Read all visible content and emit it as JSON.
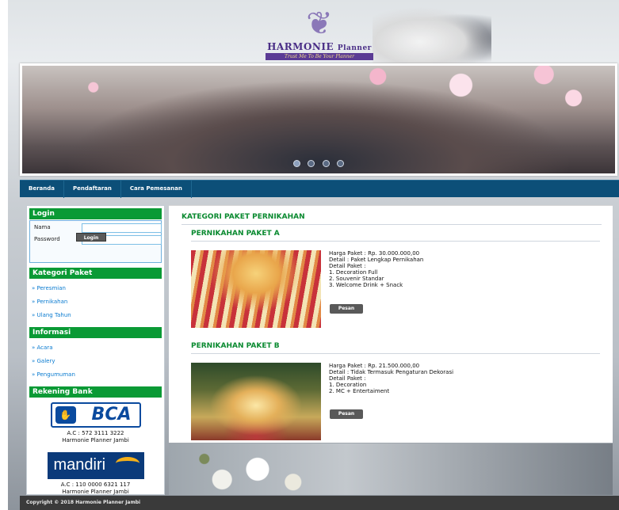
{
  "logo": {
    "title": "HARMONIE",
    "title_small": "Planner",
    "tagline": "Trust Me To Be Your Planner"
  },
  "nav": {
    "items": [
      "Beranda",
      "Pendaftaran",
      "Cara Pemesanan"
    ]
  },
  "sidebar": {
    "login": {
      "heading": "Login",
      "nama_label": "Nama",
      "password_label": "Password",
      "button": "Login"
    },
    "kategori": {
      "heading": "Kategori Paket",
      "items": [
        "» Peresmian",
        "» Pernikahan",
        "» Ulang Tahun"
      ]
    },
    "informasi": {
      "heading": "Informasi",
      "items": [
        "» Acara",
        "» Galery",
        "» Pengumuman"
      ]
    },
    "rekening": {
      "heading": "Rekening Bank",
      "bca": {
        "logo_text": "BCA",
        "account": "A.C : 572 3111 3222",
        "owner": "Harmonie Planner Jambi"
      },
      "mandiri": {
        "logo_text": "mandiri",
        "account": "A.C : 110 0000 6321 117",
        "owner": "Harmonie Planner Jambi"
      }
    }
  },
  "main": {
    "title": "KATEGORI PAKET PERNIKAHAN",
    "packages": [
      {
        "title": "PERNIKAHAN PAKET A",
        "harga": "Harga Paket : Rp. 30.000.000,00",
        "detail": "Detail : Paket Lengkap Pernikahan",
        "detail_paket": "Detail Paket :",
        "items": [
          "1. Decoration Full",
          "2. Souvenir Standar",
          "3. Welcome Drink + Snack"
        ],
        "button": "Pesan"
      },
      {
        "title": "PERNIKAHAN PAKET B",
        "harga": "Harga Paket : Rp. 21.500.000,00",
        "detail": "Detail : Tidak Termasuk Pengaturan Dekorasi",
        "detail_paket": "Detail Paket :",
        "items": [
          "1. Decoration",
          "2. MC + Entertaiment"
        ],
        "button": "Pesan"
      }
    ]
  },
  "footer": {
    "text": "Copyright © 2018 Harmonie Planner Jambi"
  },
  "colors": {
    "nav_bg": "#0c4f78",
    "sidebar_heading": "#0a9a35",
    "title_green": "#0a8a30",
    "link_blue": "#0a7bd0"
  }
}
